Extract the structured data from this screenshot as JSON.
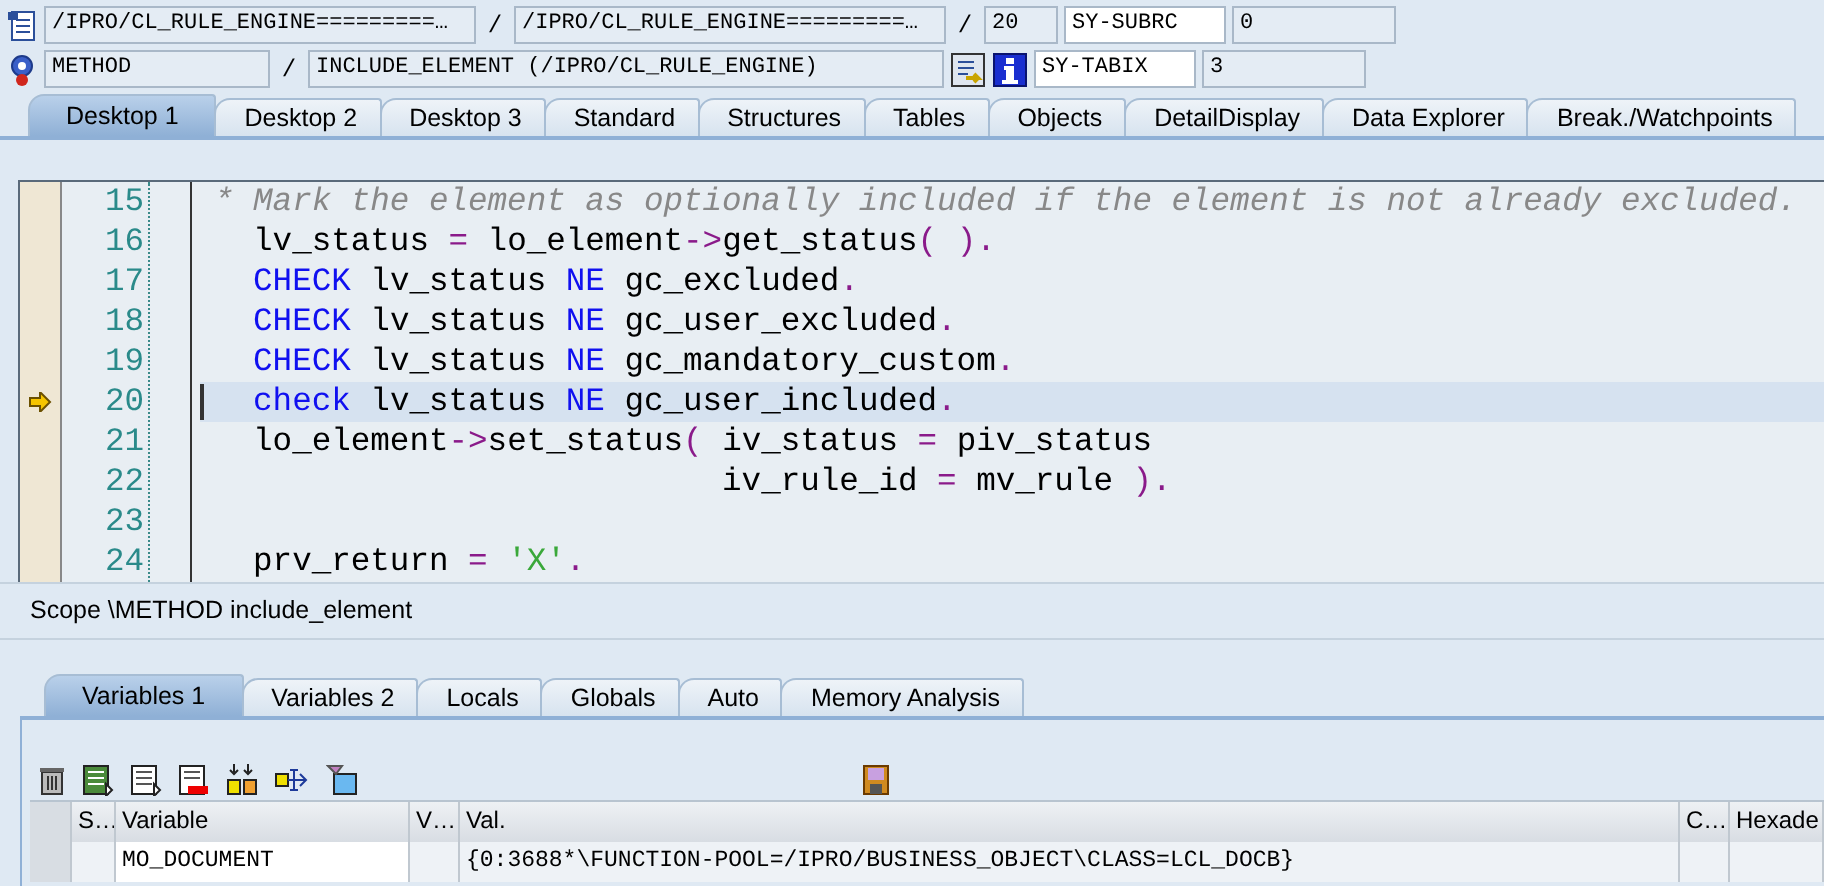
{
  "header": {
    "program": "/IPRO/CL_RULE_ENGINE=========…",
    "separator_1": "/",
    "include": "/IPRO/CL_RULE_ENGINE=========…",
    "separator_2": "/",
    "line": "20",
    "event_type": "METHOD",
    "separator_3": "/",
    "event": "INCLUDE_ELEMENT (/IPRO/CL_RULE_ENGINE)",
    "system_fields": [
      {
        "name": "SY-SUBRC",
        "value": "0"
      },
      {
        "name": "SY-TABIX",
        "value": "3"
      }
    ]
  },
  "desktop_tabs": [
    {
      "label": "Desktop 1",
      "selected": true
    },
    {
      "label": "Desktop 2",
      "selected": false
    },
    {
      "label": "Desktop 3",
      "selected": false
    },
    {
      "label": "Standard",
      "selected": false
    },
    {
      "label": "Structures",
      "selected": false
    },
    {
      "label": "Tables",
      "selected": false
    },
    {
      "label": "Objects",
      "selected": false
    },
    {
      "label": "DetailDisplay",
      "selected": false
    },
    {
      "label": "Data Explorer",
      "selected": false
    },
    {
      "label": "Break./Watchpoints",
      "selected": false
    }
  ],
  "source": {
    "lines": [
      {
        "number": "15",
        "current": false,
        "tokens": [
          {
            "kind": "comment",
            "text": "* Mark the element as optionally included if the element is not already excluded."
          }
        ]
      },
      {
        "number": "16",
        "current": false,
        "tokens": [
          {
            "kind": "text",
            "text": "  lv_status "
          },
          {
            "kind": "operator",
            "text": "="
          },
          {
            "kind": "text",
            "text": " lo_element"
          },
          {
            "kind": "operator",
            "text": "->"
          },
          {
            "kind": "text",
            "text": "get_status"
          },
          {
            "kind": "operator",
            "text": "( )."
          }
        ]
      },
      {
        "number": "17",
        "current": false,
        "tokens": [
          {
            "kind": "keyword",
            "text": "  CHECK"
          },
          {
            "kind": "text",
            "text": " lv_status "
          },
          {
            "kind": "keyword",
            "text": "NE"
          },
          {
            "kind": "text",
            "text": " gc_excluded"
          },
          {
            "kind": "operator",
            "text": "."
          }
        ]
      },
      {
        "number": "18",
        "current": false,
        "tokens": [
          {
            "kind": "keyword",
            "text": "  CHECK"
          },
          {
            "kind": "text",
            "text": " lv_status "
          },
          {
            "kind": "keyword",
            "text": "NE"
          },
          {
            "kind": "text",
            "text": " gc_user_excluded"
          },
          {
            "kind": "operator",
            "text": "."
          }
        ]
      },
      {
        "number": "19",
        "current": false,
        "tokens": [
          {
            "kind": "keyword",
            "text": "  CHECK"
          },
          {
            "kind": "text",
            "text": " lv_status "
          },
          {
            "kind": "keyword",
            "text": "NE"
          },
          {
            "kind": "text",
            "text": " gc_mandatory_custom"
          },
          {
            "kind": "operator",
            "text": "."
          }
        ]
      },
      {
        "number": "20",
        "current": true,
        "tokens": [
          {
            "kind": "keyword",
            "text": "  check"
          },
          {
            "kind": "text",
            "text": " lv_status "
          },
          {
            "kind": "keyword",
            "text": "NE"
          },
          {
            "kind": "text",
            "text": " gc_user_included"
          },
          {
            "kind": "operator",
            "text": "."
          }
        ]
      },
      {
        "number": "21",
        "current": false,
        "tokens": [
          {
            "kind": "text",
            "text": "  lo_element"
          },
          {
            "kind": "operator",
            "text": "->"
          },
          {
            "kind": "text",
            "text": "set_status"
          },
          {
            "kind": "operator",
            "text": "("
          },
          {
            "kind": "text",
            "text": " iv_status "
          },
          {
            "kind": "operator",
            "text": "="
          },
          {
            "kind": "text",
            "text": " piv_status"
          }
        ]
      },
      {
        "number": "22",
        "current": false,
        "tokens": [
          {
            "kind": "text",
            "text": "                          iv_rule_id "
          },
          {
            "kind": "operator",
            "text": "="
          },
          {
            "kind": "text",
            "text": " mv_rule "
          },
          {
            "kind": "operator",
            "text": ")."
          }
        ]
      },
      {
        "number": "23",
        "current": false
      },
      {
        "number": "24",
        "current": false,
        "tokens": [
          {
            "kind": "text",
            "text": "  prv_return "
          },
          {
            "kind": "operator",
            "text": "="
          },
          {
            "kind": "string",
            "text": " 'X'"
          },
          {
            "kind": "operator",
            "text": "."
          }
        ]
      }
    ]
  },
  "scope": "Scope \\METHOD include_element",
  "variable_tabs": [
    {
      "label": "Variables 1",
      "selected": true
    },
    {
      "label": "Variables 2",
      "selected": false
    },
    {
      "label": "Locals",
      "selected": false
    },
    {
      "label": "Globals",
      "selected": false
    },
    {
      "label": "Auto",
      "selected": false
    },
    {
      "label": "Memory Analysis",
      "selected": false
    }
  ],
  "table": {
    "columns": [
      "S…",
      "Variable",
      "V…",
      "Val.",
      "C…",
      "Hexade"
    ],
    "rows": [
      [
        "",
        "MO_DOCUMENT",
        "",
        "{0:3688*\\FUNCTION-POOL=/IPRO/BUSINESS_OBJECT\\CLASS=LCL_DOCB}",
        "",
        ""
      ]
    ]
  }
}
